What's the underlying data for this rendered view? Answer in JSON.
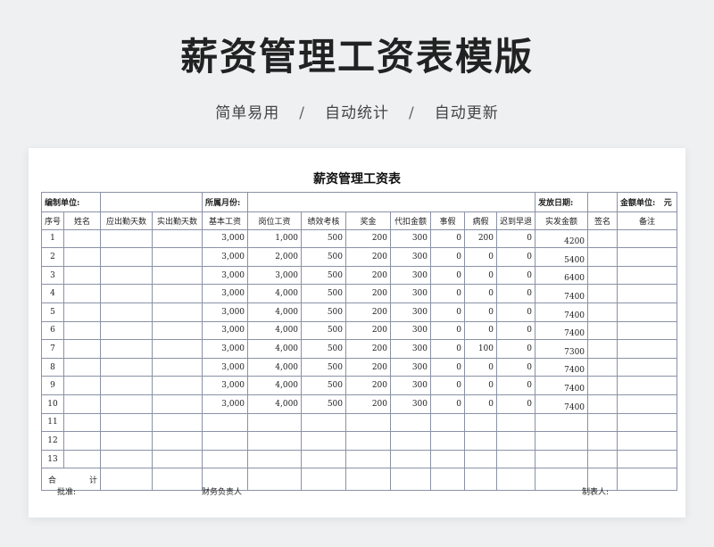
{
  "hero": {
    "title": "薪资管理工资表模版",
    "features": [
      "简单易用",
      "自动统计",
      "自动更新"
    ],
    "separator": "/"
  },
  "sheet": {
    "title": "薪资管理工资表",
    "meta": {
      "compiler_label": "编制单位:",
      "month_label": "所属月份:",
      "date_label": "发放日期:",
      "unit_label": "金额单位:",
      "unit_value": "元"
    },
    "columns": [
      "序号",
      "姓名",
      "应出勤天数",
      "实出勤天数",
      "基本工资",
      "岗位工资",
      "绩效考核",
      "奖金",
      "代扣金额",
      "事假",
      "病假",
      "迟到早退",
      "实发金额",
      "签名",
      "备注"
    ],
    "rows": [
      {
        "no": "1",
        "base": "3,000",
        "post": "1,000",
        "perf": "500",
        "bonus": "200",
        "deduct": "300",
        "personal": "0",
        "sick": "200",
        "late": "0",
        "actual": "4200"
      },
      {
        "no": "2",
        "base": "3,000",
        "post": "2,000",
        "perf": "500",
        "bonus": "200",
        "deduct": "300",
        "personal": "0",
        "sick": "0",
        "late": "0",
        "actual": "5400"
      },
      {
        "no": "3",
        "base": "3,000",
        "post": "3,000",
        "perf": "500",
        "bonus": "200",
        "deduct": "300",
        "personal": "0",
        "sick": "0",
        "late": "0",
        "actual": "6400"
      },
      {
        "no": "4",
        "base": "3,000",
        "post": "4,000",
        "perf": "500",
        "bonus": "200",
        "deduct": "300",
        "personal": "0",
        "sick": "0",
        "late": "0",
        "actual": "7400"
      },
      {
        "no": "5",
        "base": "3,000",
        "post": "4,000",
        "perf": "500",
        "bonus": "200",
        "deduct": "300",
        "personal": "0",
        "sick": "0",
        "late": "0",
        "actual": "7400"
      },
      {
        "no": "6",
        "base": "3,000",
        "post": "4,000",
        "perf": "500",
        "bonus": "200",
        "deduct": "300",
        "personal": "0",
        "sick": "0",
        "late": "0",
        "actual": "7400"
      },
      {
        "no": "7",
        "base": "3,000",
        "post": "4,000",
        "perf": "500",
        "bonus": "200",
        "deduct": "300",
        "personal": "0",
        "sick": "100",
        "late": "0",
        "actual": "7300"
      },
      {
        "no": "8",
        "base": "3,000",
        "post": "4,000",
        "perf": "500",
        "bonus": "200",
        "deduct": "300",
        "personal": "0",
        "sick": "0",
        "late": "0",
        "actual": "7400"
      },
      {
        "no": "9",
        "base": "3,000",
        "post": "4,000",
        "perf": "500",
        "bonus": "200",
        "deduct": "300",
        "personal": "0",
        "sick": "0",
        "late": "0",
        "actual": "7400"
      },
      {
        "no": "10",
        "base": "3,000",
        "post": "4,000",
        "perf": "500",
        "bonus": "200",
        "deduct": "300",
        "personal": "0",
        "sick": "0",
        "late": "0",
        "actual": "7400"
      },
      {
        "no": "11"
      },
      {
        "no": "12"
      },
      {
        "no": "13"
      }
    ],
    "total_label_a": "合",
    "total_label_b": "计",
    "footer": {
      "approve": "批准:",
      "finance": "财务负责人",
      "maker": "制表人:"
    }
  }
}
